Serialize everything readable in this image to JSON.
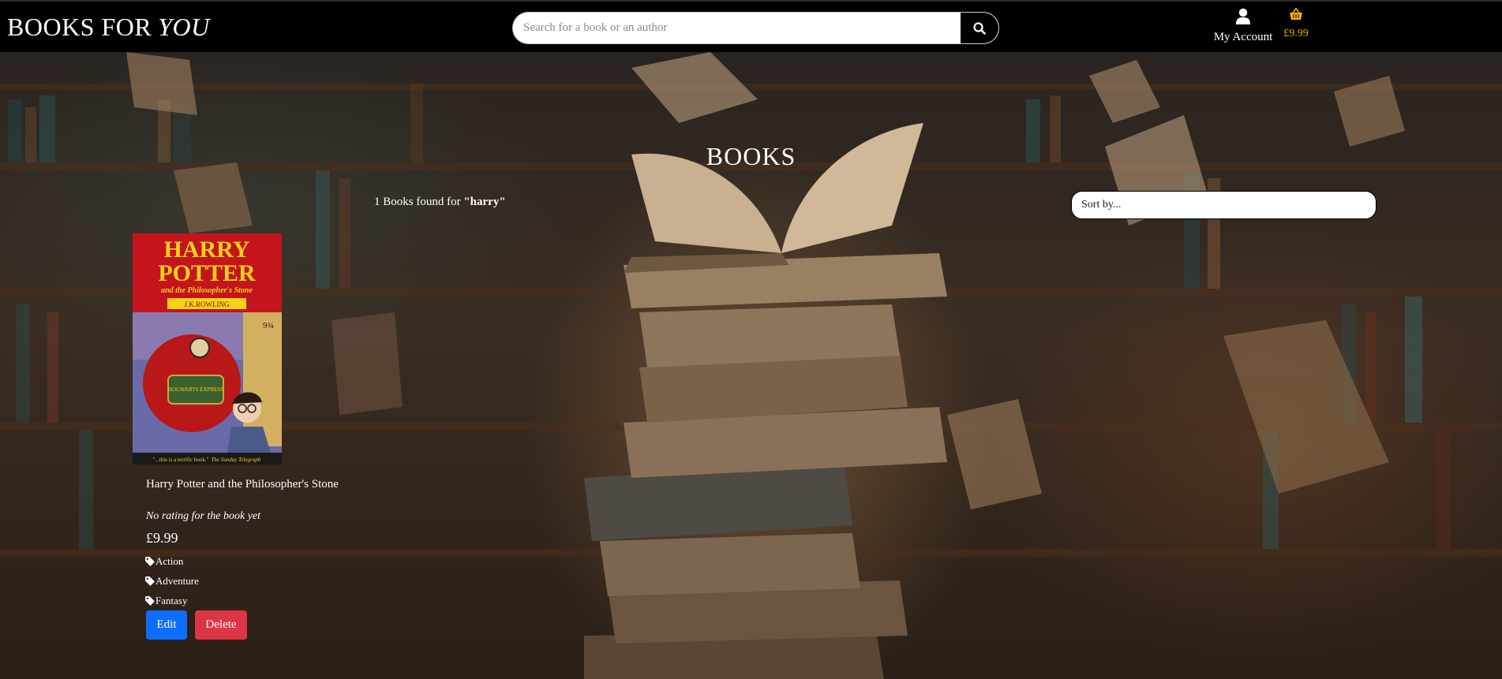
{
  "header": {
    "logo_main": "BOOKS FOR",
    "logo_accent": "YOU",
    "search_placeholder": "Search for a book or an author",
    "search_icon": "search-icon",
    "account_label": "My Account",
    "account_icon": "user-icon",
    "basket_icon": "basket-icon",
    "basket_total": "£9.99",
    "basket_color": "#f0b000"
  },
  "main": {
    "title": "BOOKS",
    "results_prefix": "1 Books found for ",
    "results_query": "\"harry\"",
    "sort_label": "Sort by..."
  },
  "book": {
    "cover": {
      "title_line1": "HARRY",
      "title_line2": "POTTER",
      "subtitle": "and the Philosopher's Stone",
      "author": "J.K.ROWLING",
      "train_sign": "HOGWARTS EXPRESS",
      "platform": "9¾",
      "quote_text": "\"...this is a terrific book.\"",
      "quote_source": "The Sunday Telegraph"
    },
    "title": "Harry Potter and the Philosopher's Stone",
    "rating_text": "No rating for the book yet",
    "price": "£9.99",
    "tags": [
      "Action",
      "Adventure",
      "Fantasy"
    ],
    "tag_icon": "tag-icon",
    "edit_label": "Edit",
    "delete_label": "Delete"
  },
  "colors": {
    "header_bg": "#000000",
    "edit_button": "#0d6efd",
    "delete_button": "#dc3545",
    "cover_red": "#c4141c",
    "cover_yellow": "#f5d21a"
  }
}
